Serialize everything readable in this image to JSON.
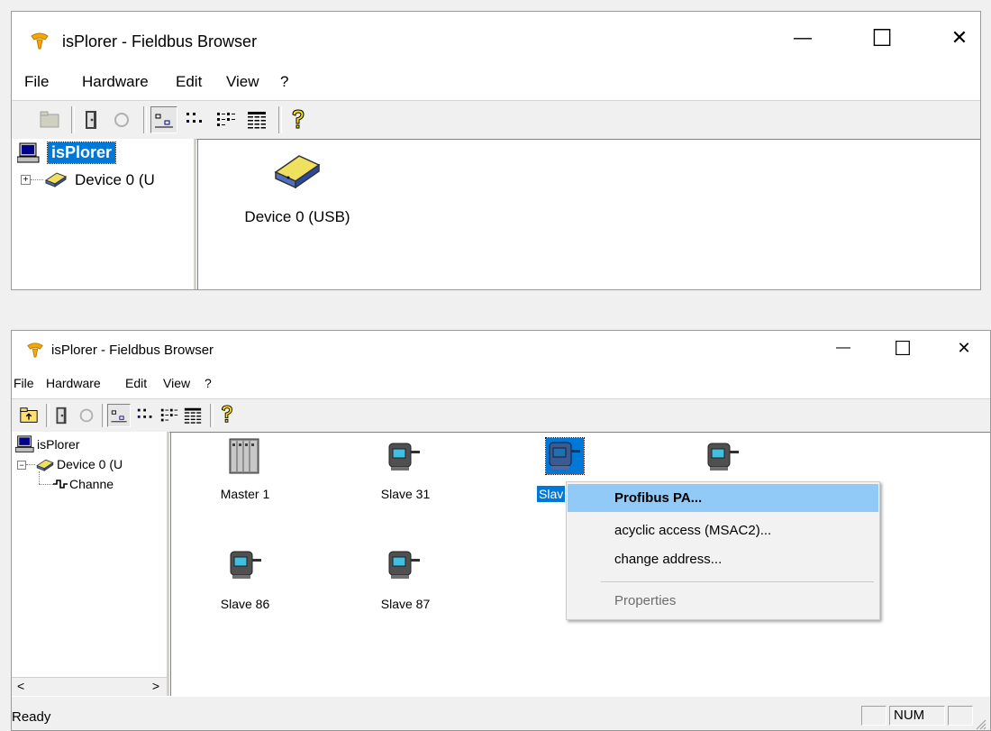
{
  "window1": {
    "title": "isPlorer - Fieldbus Browser",
    "menu": [
      "File",
      "Hardware",
      "Edit",
      "View",
      "?"
    ],
    "tree": {
      "root": "isPlorer",
      "device": "Device 0 (U"
    },
    "list": [
      {
        "label": "Device 0 (USB)",
        "icon": "usb-device-icon"
      }
    ]
  },
  "window2": {
    "title": "isPlorer - Fieldbus Browser",
    "menu": [
      "File",
      "Hardware",
      "Edit",
      "View",
      "?"
    ],
    "tree": {
      "root": "isPlorer",
      "device": "Device 0 (U",
      "channel": "Channe"
    },
    "list": [
      {
        "label": "Master 1",
        "icon": "master-rack-icon"
      },
      {
        "label": "Slave 31",
        "icon": "slave-device-icon"
      },
      {
        "label": "Slav",
        "icon": "slave-device-icon",
        "selected": true
      },
      {
        "label": "",
        "icon": "slave-device-icon"
      },
      {
        "label": "Slave 86",
        "icon": "slave-device-icon"
      },
      {
        "label": "Slave 87",
        "icon": "slave-device-icon"
      }
    ],
    "context_menu": {
      "items": [
        {
          "label": "Profibus PA...",
          "bold": true,
          "highlighted": true
        },
        {
          "label": "acyclic access (MSAC2)..."
        },
        {
          "label": "change address..."
        },
        {
          "label": "Properties",
          "disabled": true
        }
      ]
    },
    "status": {
      "text": "Ready",
      "num": "NUM"
    }
  },
  "caption": {
    "minimize": "—",
    "maximize": "☐",
    "close": "✕"
  },
  "scroll": {
    "left": "<",
    "right": ">"
  },
  "colors": {
    "selection": "#0078d7",
    "menu_highlight": "#91c9f7",
    "disabled_text": "#6d6d6d"
  }
}
